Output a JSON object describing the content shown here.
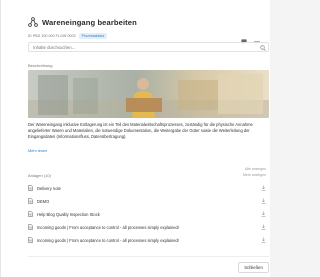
{
  "header": {
    "title": "Wareneingang bearbeiten",
    "icon": "workflow-icon"
  },
  "meta": {
    "id": "ID PBD 100 000 FLOW 0003",
    "badge": "Prozessablauf",
    "badge_color": "#2f7dc1",
    "actions": [
      "comment-icon",
      "more-icon"
    ]
  },
  "search": {
    "placeholder": "Inhalte durchsuchen..."
  },
  "description": {
    "label": "Beschreibung",
    "text": "Der Wareneingang inklusive Entlagerung ist ein Teil des Materialwirtschaftsprozesses, zuständig für die physische Annahme angelieferter Waren und Materialien, die notwendige Dokumentation, die Weitergabe der Güter sowie die Weiterleitung der Eingangsdaten (Informationsfluss, Datenübertragung).",
    "more_link": "Mehr lesen"
  },
  "attachments": {
    "header_right_top": "Alle anzeigen",
    "label": "Anlagen (10)",
    "header_right": "Mehr anzeigen",
    "items": [
      {
        "name": "Delivery note"
      },
      {
        "name": "DEMO"
      },
      {
        "name": "Help Blog Quality Inspection Stock"
      },
      {
        "name": "Incoming goods | From acceptance to control - all processes simply explained!"
      },
      {
        "name": "Incoming goods | From acceptance to control - all processes simply explained!"
      }
    ]
  },
  "footer": {
    "close_label": "Schließen"
  },
  "colors": {
    "accent": "#2f7dc1",
    "badge_bg": "#e3f0fb"
  }
}
